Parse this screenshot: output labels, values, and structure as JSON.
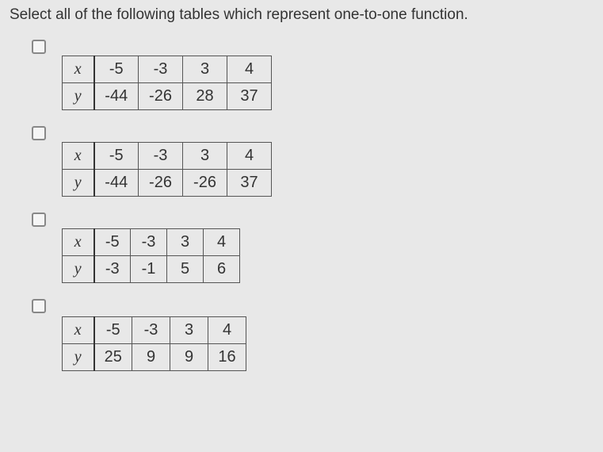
{
  "prompt": "Select all of the following tables which represent one-to-one function.",
  "row_labels": {
    "x": "x",
    "y": "y"
  },
  "tables": [
    {
      "x": [
        "-5",
        "-3",
        "3",
        "4"
      ],
      "y": [
        "-44",
        "-26",
        "28",
        "37"
      ]
    },
    {
      "x": [
        "-5",
        "-3",
        "3",
        "4"
      ],
      "y": [
        "-44",
        "-26",
        "-26",
        "37"
      ]
    },
    {
      "x": [
        "-5",
        "-3",
        "3",
        "4"
      ],
      "y": [
        "-3",
        "-1",
        "5",
        "6"
      ]
    },
    {
      "x": [
        "-5",
        "-3",
        "3",
        "4"
      ],
      "y": [
        "25",
        "9",
        "9",
        "16"
      ]
    }
  ]
}
